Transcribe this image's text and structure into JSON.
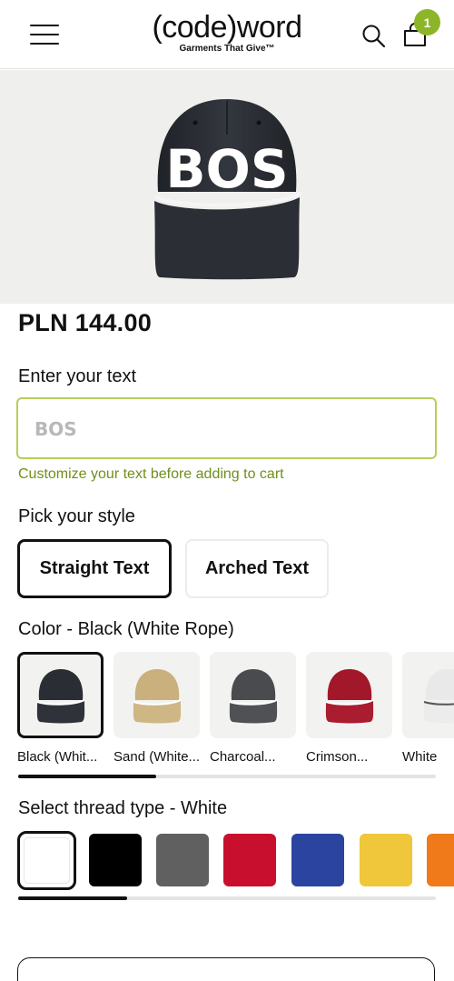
{
  "header": {
    "logo_main": "(code)word",
    "logo_sub": "Garments That Give™",
    "cart_count": "1",
    "icons": [
      "menu-icon",
      "search-icon",
      "shopping-bag-icon"
    ]
  },
  "product": {
    "cap_text": "BOS",
    "price": "PLN 144.00"
  },
  "custom_text": {
    "label": "Enter your text",
    "placeholder": "BOS",
    "value": "",
    "hint": "Customize your text before adding to cart"
  },
  "style": {
    "label": "Pick your style",
    "options": [
      "Straight Text",
      "Arched Text"
    ],
    "selected": "Straight Text"
  },
  "color": {
    "label": "Color - Black (White Rope)",
    "options": [
      {
        "label": "Black (Whit...",
        "hex": "#2a2d33"
      },
      {
        "label": "Sand (White...",
        "hex": "#c9b07d"
      },
      {
        "label": "Charcoal...",
        "hex": "#4a4b4f"
      },
      {
        "label": "Crimson...",
        "hex": "#a3172a"
      },
      {
        "label": "White",
        "hex": "#f1f1f1"
      }
    ],
    "scroll_progress": 0.33
  },
  "thread": {
    "label": "Select thread type - White",
    "options": [
      "#ffffff",
      "#000000",
      "#606060",
      "#c8102e",
      "#2a44a0",
      "#f0c63a",
      "#f07a1a"
    ],
    "scroll_progress": 0.26
  },
  "colors": {
    "accent": "#8cb528",
    "input_border": "#b5cf58",
    "hint": "#6f8f1a",
    "hero_bg": "#efefed"
  }
}
